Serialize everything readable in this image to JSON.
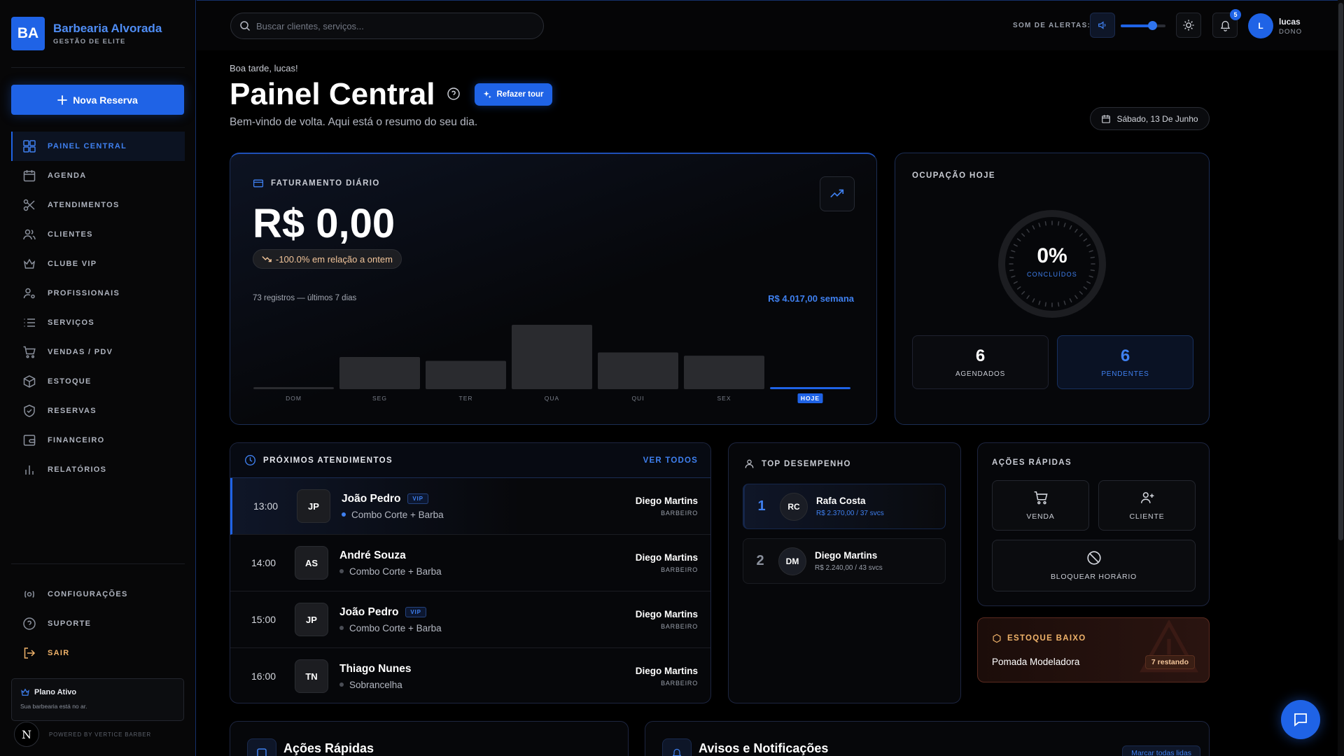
{
  "brand": {
    "initials": "BA",
    "name": "Barbearia Alvorada",
    "tagline": "GESTÃO DE ELITE"
  },
  "sidebar": {
    "new_reservation": "Nova Reserva",
    "items": [
      {
        "label": "PAINEL CENTRAL",
        "icon": "grid-icon",
        "active": true
      },
      {
        "label": "AGENDA",
        "icon": "calendar-icon"
      },
      {
        "label": "ATENDIMENTOS",
        "icon": "scissors-icon"
      },
      {
        "label": "CLIENTES",
        "icon": "users-icon"
      },
      {
        "label": "CLUBE VIP",
        "icon": "crown-icon"
      },
      {
        "label": "PROFISSIONAIS",
        "icon": "user-cog-icon"
      },
      {
        "label": "SERVIÇOS",
        "icon": "list-icon"
      },
      {
        "label": "VENDAS / PDV",
        "icon": "cart-icon"
      },
      {
        "label": "ESTOQUE",
        "icon": "box-icon"
      },
      {
        "label": "RESERVAS",
        "icon": "shield-check-icon"
      },
      {
        "label": "FINANCEIRO",
        "icon": "wallet-icon"
      },
      {
        "label": "RELATÓRIOS",
        "icon": "bar-chart-icon"
      }
    ],
    "bottom": [
      {
        "label": "CONFIGURAÇÕES",
        "icon": "settings-icon"
      },
      {
        "label": "SUPORTE",
        "icon": "help-circle-icon"
      },
      {
        "label": "SAIR",
        "icon": "logout-icon"
      }
    ],
    "plan": {
      "title": "Plano Ativo",
      "subtitle": "Sua barbearia está no ar."
    },
    "powered": "POWERED BY VERTICE BARBER",
    "n_badge": "N"
  },
  "topbar": {
    "search_placeholder": "Buscar clientes, serviços...",
    "sound_label": "SOM DE ALERTAS:",
    "volume": 0.7,
    "notifications": "5",
    "user": {
      "initial": "L",
      "name": "lucas",
      "role": "DONO"
    }
  },
  "header": {
    "greeting": "Boa tarde, lucas!",
    "title": "Painel Central",
    "tour_button": "Refazer tour",
    "subtitle": "Bem-vindo de volta. Aqui está o resumo do seu dia.",
    "date": "Sábado, 13 De Junho"
  },
  "revenue": {
    "label": "FATURAMENTO DIÁRIO",
    "amount": "R$ 0,00",
    "change": "-100.0% em relação a ontem",
    "records_note": "73 registros — últimos 7 dias",
    "week_total": "R$ 4.017,00 semana"
  },
  "chart_data": {
    "type": "bar",
    "categories": [
      "DOM",
      "SEG",
      "TER",
      "QUA",
      "QUI",
      "SEX",
      "HOJE"
    ],
    "values": [
      0.03,
      0.5,
      0.44,
      1.0,
      0.57,
      0.52,
      0.03
    ],
    "highlight": "HOJE",
    "colors": {
      "bar": "#2a2b2f",
      "today": "#1f63e6"
    }
  },
  "occupancy": {
    "label": "OCUPAÇÃO HOJE",
    "percent": "0%",
    "sub": "CONCLUÍDOS",
    "scheduled_value": "6",
    "scheduled_label": "AGENDADOS",
    "pending_value": "6",
    "pending_label": "PENDENTES"
  },
  "upcoming": {
    "label": "PRÓXIMOS ATENDIMENTOS",
    "see_all": "VER TODOS",
    "items": [
      {
        "time": "13:00",
        "initials": "JP",
        "name": "João Pedro",
        "vip": "VIP",
        "service": "Combo Corte + Barba",
        "pro": "Diego Martins",
        "role": "BARBEIRO"
      },
      {
        "time": "14:00",
        "initials": "AS",
        "name": "André Souza",
        "vip": "",
        "service": "Combo Corte + Barba",
        "pro": "Diego Martins",
        "role": "BARBEIRO"
      },
      {
        "time": "15:00",
        "initials": "JP",
        "name": "João Pedro",
        "vip": "VIP",
        "service": "Combo Corte + Barba",
        "pro": "Diego Martins",
        "role": "BARBEIRO"
      },
      {
        "time": "16:00",
        "initials": "TN",
        "name": "Thiago Nunes",
        "vip": "",
        "service": "Sobrancelha",
        "pro": "Diego Martins",
        "role": "BARBEIRO"
      }
    ]
  },
  "performance": {
    "label": "TOP DESEMPENHO",
    "items": [
      {
        "rank": "1",
        "initials": "RC",
        "name": "Rafa Costa",
        "stat": "R$ 2.370,00 / 37 svcs"
      },
      {
        "rank": "2",
        "initials": "DM",
        "name": "Diego Martins",
        "stat": "R$ 2.240,00 / 43 svcs"
      }
    ]
  },
  "quick_actions": {
    "label": "AÇÕES RÁPIDAS",
    "sale": "VENDA",
    "client": "CLIENTE",
    "block": "BLOQUEAR HORÁRIO"
  },
  "low_stock": {
    "label": "ESTOQUE BAIXO",
    "item": "Pomada Modeladora",
    "remaining": "7 restando"
  },
  "bottom_cards": {
    "quick_actions_title": "Ações Rápidas",
    "notices_title": "Avisos e Notificações",
    "mark_all_read": "Marcar todas lidas"
  }
}
